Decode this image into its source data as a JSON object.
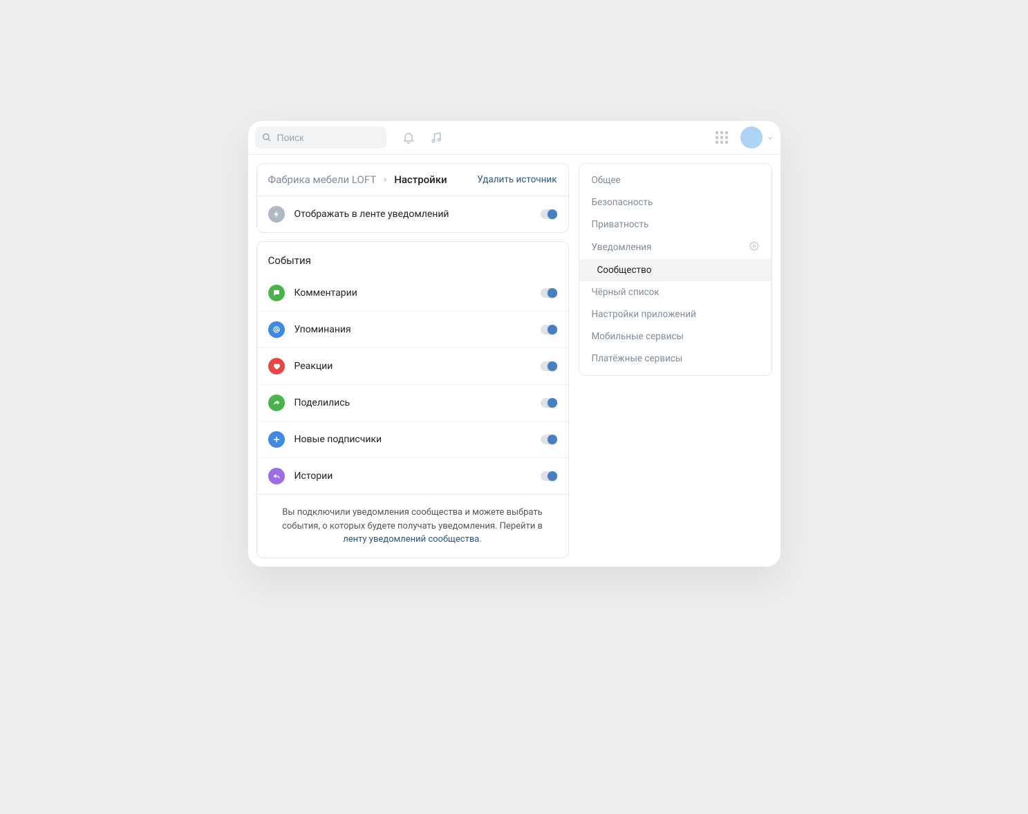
{
  "topbar": {
    "search_placeholder": "Поиск"
  },
  "header": {
    "breadcrumb_source": "Фабрика мебели LOFT",
    "breadcrumb_current": "Настройки",
    "delete_label": "Удалить источник"
  },
  "feed_toggle": {
    "label": "Отображать в ленте уведомлений"
  },
  "events": {
    "title": "События",
    "items": [
      {
        "label": "Комментарии"
      },
      {
        "label": "Упоминания"
      },
      {
        "label": "Реакции"
      },
      {
        "label": "Поделились"
      },
      {
        "label": "Новые подписчики"
      },
      {
        "label": "Истории"
      }
    ]
  },
  "footer": {
    "text_before": "Вы подключили уведомления сообщества и можете выбрать события, о которых будете получать уведомления. Перейти в ",
    "link": "ленту уведомлений сообщества",
    "text_after": "."
  },
  "sidebar": {
    "items": [
      {
        "label": "Общее"
      },
      {
        "label": "Безопасность"
      },
      {
        "label": "Приватность"
      },
      {
        "label": "Уведомления"
      },
      {
        "label": "Сообщество"
      },
      {
        "label": "Чёрный список"
      },
      {
        "label": "Настройки приложений"
      },
      {
        "label": "Мобильные сервисы"
      },
      {
        "label": "Платёжные сервисы"
      }
    ]
  }
}
